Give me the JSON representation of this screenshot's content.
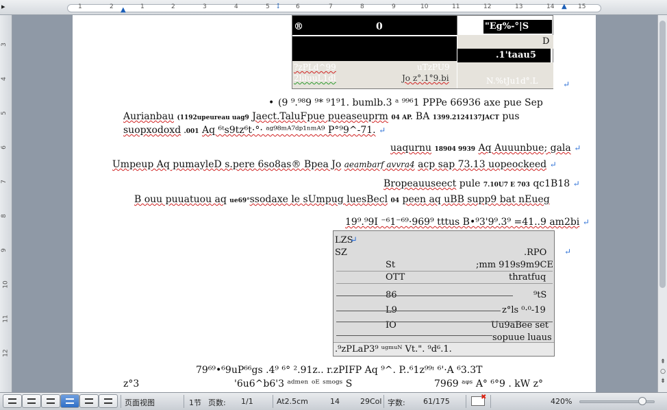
{
  "ruler": {
    "corner_glyph": "▸",
    "ticks": [
      "1",
      "2",
      "1",
      "1",
      "2",
      "3",
      "4",
      "5",
      "6",
      "7",
      "8",
      "9",
      "10",
      "11",
      "12",
      "13",
      "14",
      "15"
    ]
  },
  "vruler": {
    "ticks": [
      "3",
      "4",
      "5",
      "6",
      "7",
      "8",
      "9",
      "10",
      "11",
      "12"
    ]
  },
  "top_table": {
    "c1": "®",
    "c2": "0",
    "c3": "\"Eg%-°|S",
    "c4": "D",
    "c5": ".1'taau5",
    "c6": "?zPLd^99",
    "c7": "uTzPU9",
    "c8": "2liluuL1dl",
    "c9": "Jo z°.1°9.bi",
    "c10": "N.%tJu1d°.L"
  },
  "body": {
    "bullet": "•",
    "l1": "(9 ⁹.⁹⁸9 ⁹* ⁹1⁹1. bumlb.3 ᵃ ⁹⁹⁶1 PPPe 66936 axe pue Sep",
    "l2a": "Aurianbau",
    "l2b": "(1192upeureau uag9",
    "l2c": "Jaect.TaluFpue pueaseuprm",
    "l2d": "04 AP.",
    "l2e": "BA",
    "l2f": "1399.2124137JACT",
    "l2g": "pus",
    "l3a": "suopxodoxd",
    "l3b": ".001",
    "l3c": "Aq ⁶ᵗs9tz⁶t·°· ᵃᵍ⁹⁸ᵐᴬ⁷ᵈᵖ¹ⁿᵐᴬ⁹ P°⁹9^-71.",
    "l4a": "uaqurnu",
    "l4b": "18904 9939",
    "l4c": "Aq Auuunbue; gala",
    "l5a": "Umpeup Aq pumayleD s.pere 6so8as® Bpea Jo",
    "l5b": "aeambarf avvra4",
    "l5c": "acp sap 73.13 uopeockeed",
    "l6a": "Bropeauuseect",
    "l6b": "pule",
    "l6c": "7.10U7 E 703",
    "l6d": "qc1B18",
    "l7a": "B ouu puuatuou aq",
    "l7b": "ue69°",
    "l7c": "ssodaxe le sUmpug luesBecl",
    "l7d": "04",
    "l7e": "peen aq uBB supp9 bat nEueg",
    "l8": "19⁹.⁹9I ⁻⁶1⁻⁶⁹·969⁹ tttus B•⁹3'9⁹.3⁹ =41..9 am2bi",
    "bottom1": "79⁶⁹•⁶9uP⁶⁶gs .4⁹ ⁶° ².91z.. r.zPIFP Aq ⁹^. P..⁶1z⁹⁹ᶦ ⁶'·A ⁶3.3T",
    "bottom2a": "z°3",
    "bottom2b": "'6u6^b6'3 ᵃᵈᵐᵉⁿ ᵒᴱ ˢᵐᵒᵍˢ S",
    "bottom2c": "7969 ᵃᵠˢ A° ⁶°9 . kW z°"
  },
  "gray_table": {
    "r1": "LZS",
    "r2a": "SZ",
    "r2b": ".RPO",
    "r3a": "St",
    "r3b": ";mm 919s9m9CE",
    "r4a": "OTT",
    "r4b": "thratfuq",
    "r5a": "86",
    "r5b": "⁹tS",
    "r6a": "L9",
    "r6b": "z°ls ⁰·⁰-19",
    "r7a": "IO",
    "r7b": "Uu9aBee set",
    "r8": "sopuue luaus",
    "footer": ".⁹zPLaP3⁹ ᵘᵍᵐᵘᴺ Vt.\". ⁹d⁶.1."
  },
  "status": {
    "view": "页面视图",
    "section": "1节",
    "pages_label": "页数:",
    "pages": "1/1",
    "at": "At2.5cm",
    "line": "14",
    "col": "29Col",
    "words_label": "字数:",
    "words": "61/175",
    "zoom": "420%"
  },
  "scroll": {
    "up": "⇞",
    "circle": "○",
    "down": "⇟"
  },
  "pilcrow": "↵"
}
